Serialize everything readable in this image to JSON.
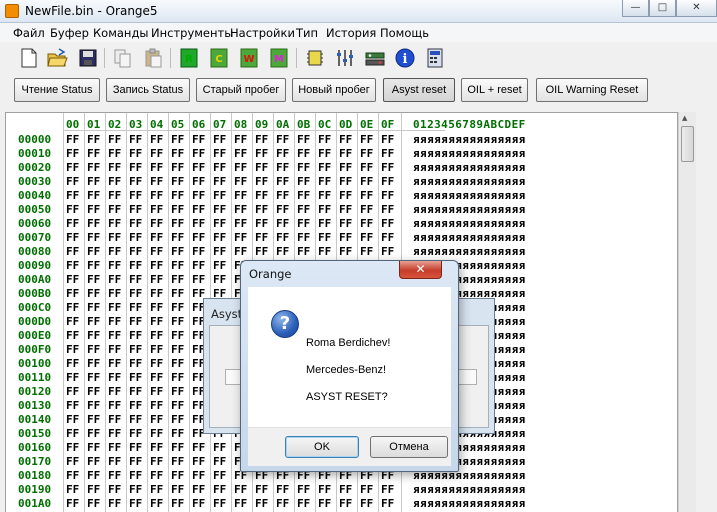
{
  "window": {
    "title": "NewFile.bin - Orange5",
    "minimize": "—",
    "maximize": "□",
    "close": "✕"
  },
  "menu": [
    "Файл",
    "Буфер",
    "Команды",
    "Инструменты",
    "Настройки",
    "Тип",
    "История",
    "Помощь"
  ],
  "toolbar": {
    "icons": [
      "new-file-icon",
      "open-folder-icon",
      "save-disk-icon",
      "copy-icon",
      "paste-icon",
      "read-icon",
      "check-icon",
      "write-icon",
      "memory-icon",
      "chip-icon",
      "settings-sliders-icon",
      "adapter-icon",
      "info-icon",
      "calculator-icon"
    ],
    "letters": {
      "r": "R",
      "c": "C",
      "w": "W",
      "m": "M"
    },
    "info": "i"
  },
  "actions": [
    "Чтение Status",
    "Запись Status",
    "Старый пробег",
    "Новый пробег",
    "Asyst reset",
    "OIL + reset",
    "OIL Warning Reset"
  ],
  "hex": {
    "columns": [
      "00",
      "01",
      "02",
      "03",
      "04",
      "05",
      "06",
      "07",
      "08",
      "09",
      "0A",
      "0B",
      "0C",
      "0D",
      "0E",
      "0F"
    ],
    "ascii_header": "0123456789ABCDEF",
    "fill_byte": "FF",
    "fill_ascii": "яяяяяяяяяяяяяяяя",
    "addresses": [
      "00000",
      "00010",
      "00020",
      "00030",
      "00040",
      "00050",
      "00060",
      "00070",
      "00080",
      "00090",
      "000A0",
      "000B0",
      "000C0",
      "000D0",
      "000E0",
      "000F0",
      "00100",
      "00110",
      "00120",
      "00130",
      "00140",
      "00150",
      "00160",
      "00170",
      "00180",
      "00190",
      "001A0"
    ]
  },
  "background_dialog": {
    "title": "Asyst r"
  },
  "dialog": {
    "title": "Orange",
    "close": "✕",
    "icon": "?",
    "lines": [
      "Roma Berdichev!",
      "Mercedes-Benz!",
      "ASYST RESET?"
    ],
    "ok": "OK",
    "cancel": "Отмена"
  },
  "colors": {
    "accent_green": "#006f00",
    "title_bar": "#dde7f2",
    "close_red": "#c63d2a"
  }
}
